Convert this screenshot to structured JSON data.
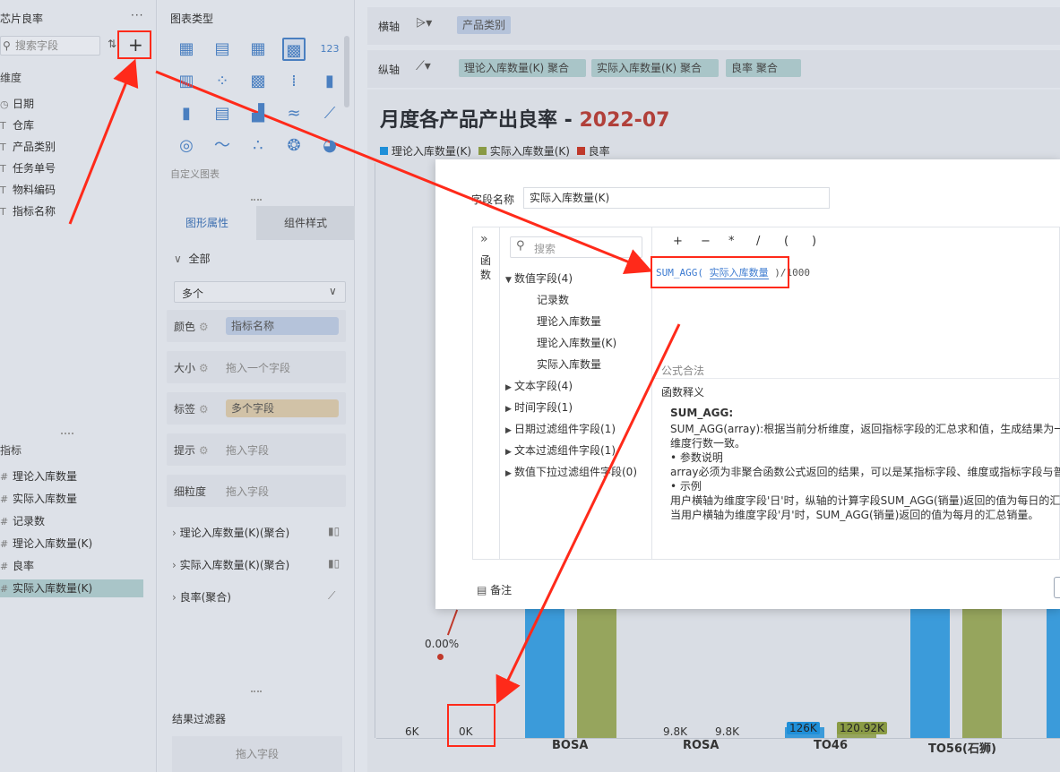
{
  "left_panel": {
    "title": "芯片良率",
    "more": "···",
    "search_placeholder": "搜索字段",
    "dimension_header": "维度",
    "dimensions": [
      {
        "icon": "calendar-icon",
        "glyph": "◷",
        "label": "日期"
      },
      {
        "icon": "text-field-icon",
        "glyph": "T",
        "label": "仓库"
      },
      {
        "icon": "text-field-icon",
        "glyph": "T",
        "label": "产品类别"
      },
      {
        "icon": "text-field-icon",
        "glyph": "T",
        "label": "任务单号"
      },
      {
        "icon": "text-field-icon",
        "glyph": "T",
        "label": "物料编码"
      },
      {
        "icon": "text-field-icon",
        "glyph": "T",
        "label": "指标名称"
      }
    ],
    "measure_header": "指标",
    "measures": [
      {
        "icon": "number-field-icon",
        "glyph": "#",
        "label": "理论入库数量"
      },
      {
        "icon": "number-field-icon",
        "glyph": "#",
        "label": "实际入库数量"
      },
      {
        "icon": "number-field-icon",
        "glyph": "#",
        "label": "记录数"
      },
      {
        "icon": "number-field-icon",
        "glyph": "#",
        "label": "理论入库数量(K)"
      },
      {
        "icon": "number-field-icon",
        "glyph": "#",
        "label": "良率"
      },
      {
        "icon": "number-field-icon",
        "glyph": "#",
        "label": "实际入库数量(K)"
      }
    ]
  },
  "mid_panel": {
    "chart_type_header": "图表类型",
    "custom_chart": "自定义图表",
    "tabs": [
      "图形属性",
      "组件样式"
    ],
    "all_label": "全部",
    "multi_select": "多个",
    "color_label": "颜色",
    "color_value": "指标名称",
    "size_label": "大小",
    "size_placeholder": "拖入一个字段",
    "label_label": "标签",
    "label_value": "多个字段",
    "tooltip_label": "提示",
    "tooltip_placeholder": "拖入字段",
    "granularity_label": "细粒度",
    "granularity_placeholder": "拖入字段",
    "series": [
      "理论入库数量(K)(聚合)",
      "实际入库数量(K)(聚合)",
      "良率(聚合)"
    ],
    "result_filter": "结果过滤器",
    "result_filter_placeholder": "拖入字段"
  },
  "axes": {
    "x_label": "横轴",
    "x_tags": [
      "产品类别"
    ],
    "y_label": "纵轴",
    "y_tags": [
      "理论入库数量(K)  聚合",
      "实际入库数量(K)  聚合",
      "良率    聚合"
    ]
  },
  "chart": {
    "title_main": "月度各产品产出良率 - ",
    "title_date": "2022-07",
    "legend": [
      "理论入库数量(K)",
      "实际入库数量(K)",
      "良率"
    ],
    "colors": {
      "theory": "#1f8fd8",
      "actual": "#8a9b45",
      "yield": "#c0392b"
    }
  },
  "chart_data": {
    "type": "bar",
    "title": "月度各产品产出良率 - 2022-07",
    "categories": [
      "",
      "",
      "BOSA",
      "ROSA",
      "TO46",
      "TO56(石狮)"
    ],
    "series": [
      {
        "name": "理论入库数量(K)",
        "data_labels": [
          "6K",
          "",
          "",
          "9.8K",
          "126K",
          ""
        ]
      },
      {
        "name": "实际入库数量(K)",
        "data_labels": [
          "",
          "0K",
          "",
          "9.8K",
          "120.92K",
          ""
        ]
      },
      {
        "name": "良率",
        "data_labels": [
          "",
          "0.00%",
          "",
          "",
          "",
          ""
        ]
      }
    ]
  },
  "dialog": {
    "field_name_label": "字段名称",
    "field_name_value": "实际入库数量(K)",
    "func_toggle": "»",
    "func_label": "函数",
    "search_placeholder": "搜索",
    "operators": [
      "+",
      "−",
      "*",
      "/",
      "(",
      ")"
    ],
    "formula_func": "SUM_AGG(",
    "formula_field": "实际入库数量",
    "formula_rest": ")/1000",
    "tree": {
      "numeric_group": "数值字段(4)",
      "numeric_items": [
        "记录数",
        "理论入库数量",
        "理论入库数量(K)",
        "实际入库数量"
      ],
      "groups": [
        "文本字段(4)",
        "时间字段(1)",
        "日期过滤组件字段(1)",
        "文本过滤组件字段(1)",
        "数值下拉过滤组件字段(0)"
      ]
    },
    "formula_valid": "公式合法",
    "func_explain": "函数释义",
    "explain": {
      "title": "SUM_AGG:",
      "lines": [
        "SUM_AGG(array):根据当前分析维度，返回指标字段的汇总求和值，生成结果为一",
        "维度行数一致。",
        "• 参数说明",
        "array必须为非聚合函数公式返回的结果，可以是某指标字段、维度或指标字段与普",
        "• 示例",
        "用户横轴为维度字段'日'时，纵轴的计算字段SUM_AGG(销量)返回的值为每日的汇",
        "当用户横轴为维度字段'月'时，SUM_AGG(销量)返回的值为每月的汇总销量。"
      ]
    },
    "note": "备注"
  }
}
